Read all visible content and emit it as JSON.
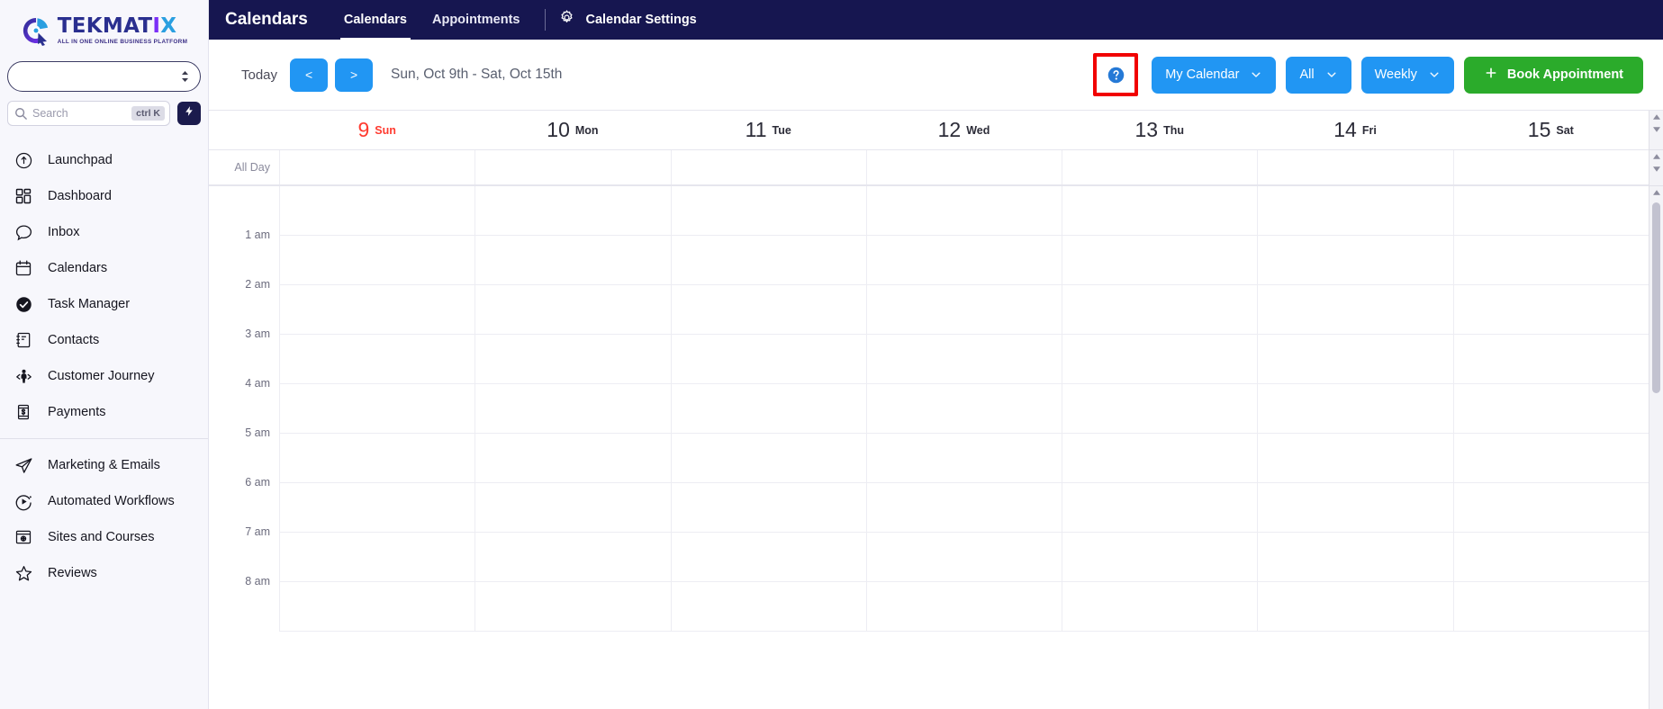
{
  "brand": {
    "name_part1": "TEKMAT",
    "name_part2": "I",
    "name_part3": "X",
    "tagline": "ALL IN ONE ONLINE BUSINESS PLATFORM",
    "logo_icon": "tekmatix-logo-icon"
  },
  "sidebar": {
    "account_select_value": "",
    "account_select_icon": "chevron-updown-icon",
    "search": {
      "placeholder": "Search",
      "icon": "search-icon",
      "shortcut": "ctrl K"
    },
    "quick_action_icon": "lightning-bolt-icon",
    "items": [
      {
        "label": "Launchpad",
        "icon": "launchpad-icon"
      },
      {
        "label": "Dashboard",
        "icon": "dashboard-grid-icon"
      },
      {
        "label": "Inbox",
        "icon": "chat-bubble-icon"
      },
      {
        "label": "Calendars",
        "icon": "calendar-icon"
      },
      {
        "label": "Task Manager",
        "icon": "check-circle-icon"
      },
      {
        "label": "Contacts",
        "icon": "contacts-book-icon"
      },
      {
        "label": "Customer Journey",
        "icon": "customer-journey-icon"
      },
      {
        "label": "Payments",
        "icon": "payments-icon"
      }
    ],
    "items_secondary": [
      {
        "label": "Marketing & Emails",
        "icon": "paper-plane-icon"
      },
      {
        "label": "Automated Workflows",
        "icon": "play-circle-icon"
      },
      {
        "label": "Sites and Courses",
        "icon": "browser-window-icon"
      },
      {
        "label": "Reviews",
        "icon": "star-icon"
      }
    ]
  },
  "topbar": {
    "title": "Calendars",
    "tabs": [
      {
        "label": "Calendars",
        "active": true
      },
      {
        "label": "Appointments",
        "active": false
      }
    ],
    "settings_label": "Calendar Settings",
    "settings_icon": "gear-icon",
    "background_color": "#161650"
  },
  "toolbar": {
    "today_label": "Today",
    "prev_label": "<",
    "next_label": ">",
    "date_range": "Sun, Oct 9th - Sat, Oct 15th",
    "help_icon": "help-circle-icon",
    "help_highlight_color": "#f10000",
    "calendar_filter": "My Calendar",
    "group_filter": "All",
    "view_filter": "Weekly",
    "dropdown_icon": "chevron-down-icon",
    "book_label": "Book Appointment",
    "book_icon": "plus-icon",
    "book_color": "#2bab2b",
    "accent_color": "#2196f3"
  },
  "calendar": {
    "all_day_label": "All Day",
    "days": [
      {
        "num": "9",
        "name": "Sun",
        "today": true
      },
      {
        "num": "10",
        "name": "Mon",
        "today": false
      },
      {
        "num": "11",
        "name": "Tue",
        "today": false
      },
      {
        "num": "12",
        "name": "Wed",
        "today": false
      },
      {
        "num": "13",
        "name": "Thu",
        "today": false
      },
      {
        "num": "14",
        "name": "Fri",
        "today": false
      },
      {
        "num": "15",
        "name": "Sat",
        "today": false
      }
    ],
    "times": [
      "1 am",
      "2 am",
      "3 am",
      "4 am",
      "5 am",
      "6 am",
      "7 am",
      "8 am"
    ],
    "today_color": "#ff3b30"
  }
}
